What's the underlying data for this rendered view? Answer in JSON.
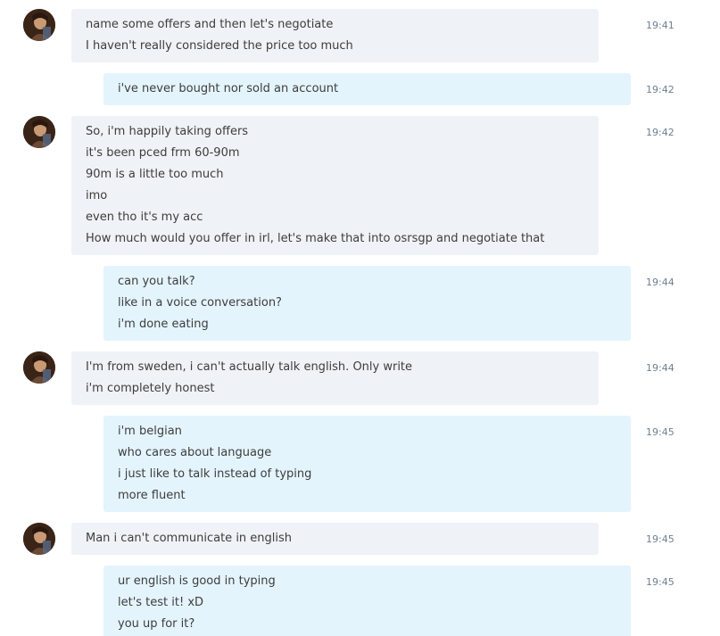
{
  "chat": {
    "messages": [
      {
        "sender": "them",
        "time": "19:41",
        "lines": [
          "name some offers and then let's negotiate",
          "I haven't really considered the price too much"
        ]
      },
      {
        "sender": "me",
        "time": "19:42",
        "lines": [
          "i've never bought nor sold an account"
        ]
      },
      {
        "sender": "them",
        "time": "19:42",
        "lines": [
          "So, i'm happily taking offers",
          "it's been pced frm 60-90m",
          "90m is a little too much",
          "imo",
          "even tho it's my acc",
          "How much would you offer in irl, let's make that into osrsgp and negotiate that"
        ]
      },
      {
        "sender": "me",
        "time": "19:44",
        "lines": [
          "can you talk?",
          "like in a voice conversation?",
          "i'm done eating"
        ]
      },
      {
        "sender": "them",
        "time": "19:44",
        "lines": [
          "I'm from sweden, i can't actually talk english. Only write",
          "i'm completely honest"
        ]
      },
      {
        "sender": "me",
        "time": "19:45",
        "lines": [
          "i'm belgian",
          "who cares about language",
          "i just like to talk instead of typing",
          "more fluent"
        ]
      },
      {
        "sender": "them",
        "time": "19:45",
        "lines": [
          "Man i can't communicate in english"
        ]
      },
      {
        "sender": "me",
        "time": "19:45",
        "lines": [
          "ur english is good in typing",
          "let's test it! xD",
          "you up for it?"
        ]
      }
    ]
  }
}
